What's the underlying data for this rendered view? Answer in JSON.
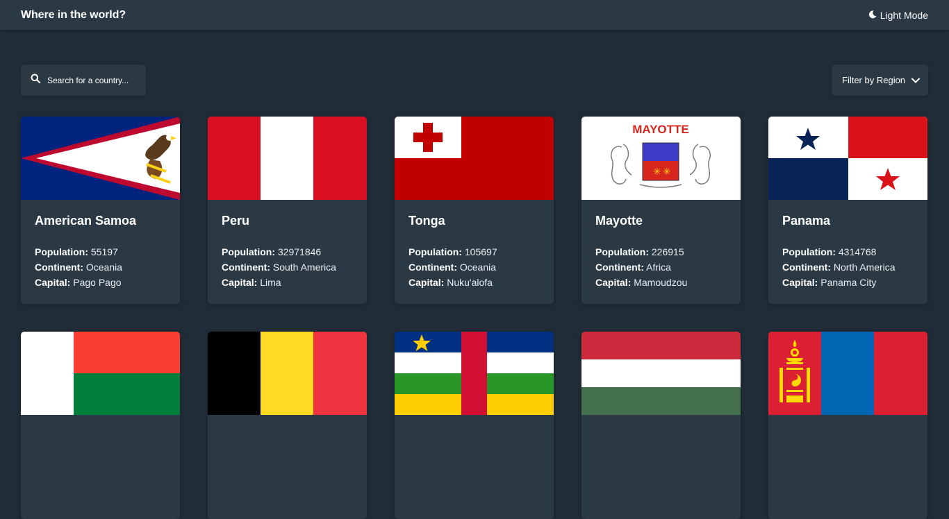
{
  "header": {
    "title": "Where in the world?",
    "mode_label": "Light Mode"
  },
  "search": {
    "placeholder": "Search for a country..."
  },
  "filter": {
    "label": "Filter by Region"
  },
  "labels": {
    "population": "Population:",
    "continent": "Continent:",
    "capital": "Capital:"
  },
  "countries": [
    {
      "name": "American Samoa",
      "population": "55197",
      "continent": "Oceania",
      "capital": "Pago Pago",
      "flag": "american-samoa-flag"
    },
    {
      "name": "Peru",
      "population": "32971846",
      "continent": "South America",
      "capital": "Lima",
      "flag": "peru-flag"
    },
    {
      "name": "Tonga",
      "population": "105697",
      "continent": "Oceania",
      "capital": "Nuku'alofa",
      "flag": "tonga-flag"
    },
    {
      "name": "Mayotte",
      "population": "226915",
      "continent": "Africa",
      "capital": "Mamoudzou",
      "flag": "mayotte-flag",
      "flag_text": "MAYOTTE"
    },
    {
      "name": "Panama",
      "population": "4314768",
      "continent": "North America",
      "capital": "Panama City",
      "flag": "panama-flag"
    },
    {
      "name": "",
      "flag": "madagascar-flag"
    },
    {
      "name": "",
      "flag": "belgium-flag"
    },
    {
      "name": "",
      "flag": "central-african-republic-flag"
    },
    {
      "name": "",
      "flag": "hungary-flag"
    },
    {
      "name": "",
      "flag": "mongolia-flag"
    }
  ],
  "colors": {
    "background": "#202c37",
    "element": "#2b3945",
    "text": "#ffffff"
  }
}
